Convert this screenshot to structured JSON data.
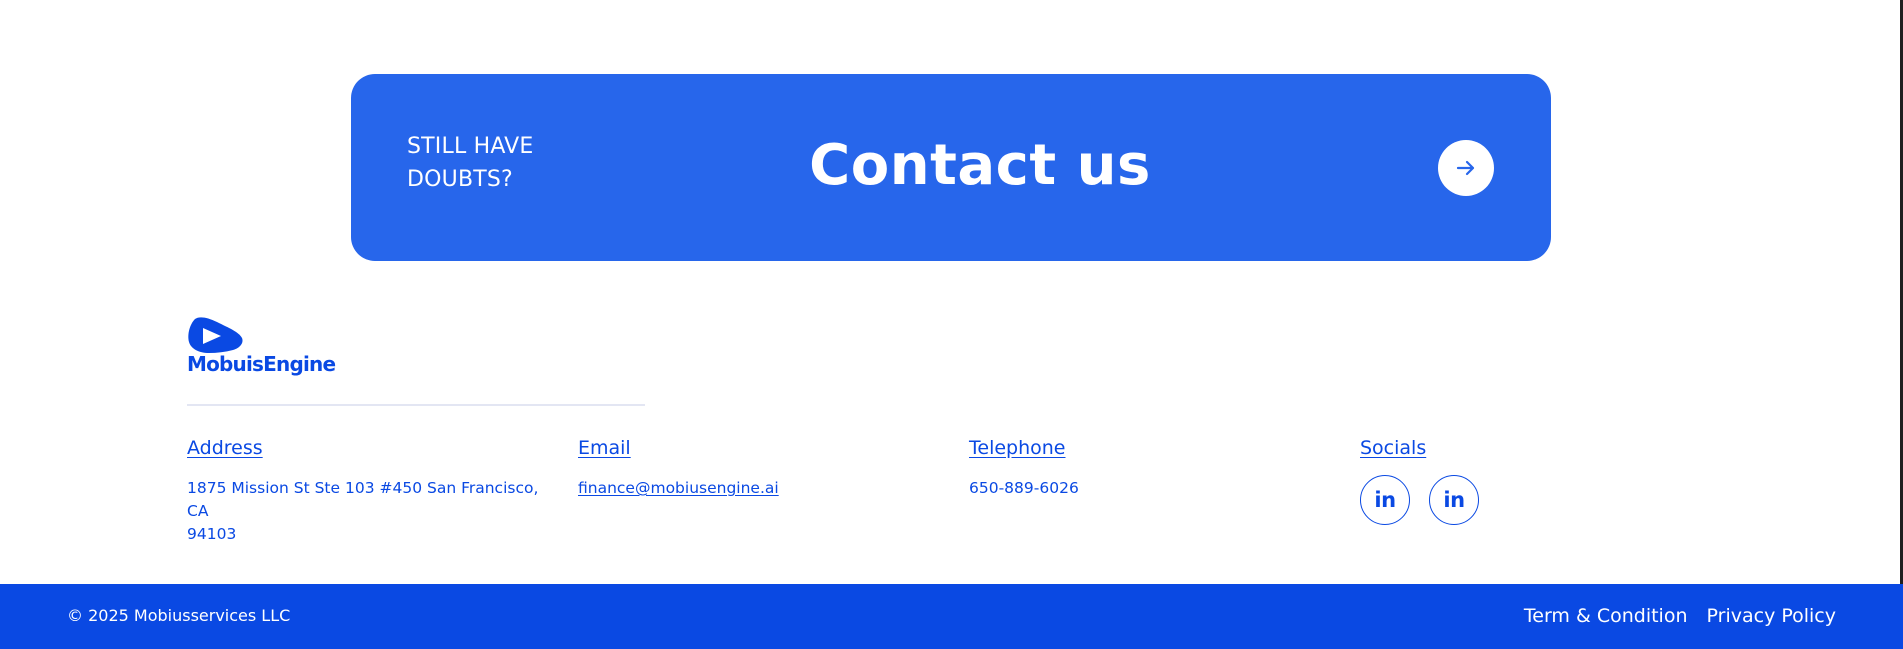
{
  "colors": {
    "cta_background": "#2766eb",
    "brand_blue": "#0a49e3",
    "divider": "#e3e6f3",
    "background": "#ffffff"
  },
  "cta": {
    "kicker_line1": "STILL HAVE",
    "kicker_line2": "DOUBTS?",
    "title": "Contact us",
    "arrow_icon": "arrow-right-icon"
  },
  "logo": {
    "text": "MobuisEngine"
  },
  "contact": {
    "address": {
      "heading": "Address",
      "line1": "1875 Mission St Ste 103 #450 San Francisco, CA",
      "line2": "94103"
    },
    "email": {
      "heading": "Email",
      "value": "finance@mobiusengine.ai"
    },
    "telephone": {
      "heading": "Telephone",
      "value": "650-889-6026"
    },
    "socials": {
      "heading": "Socials",
      "items": [
        {
          "icon": "linkedin-icon",
          "glyph": "in"
        },
        {
          "icon": "linkedin-icon",
          "glyph": "in"
        }
      ]
    }
  },
  "footer": {
    "copyright": "© 2025 Mobiusservices LLC",
    "links": [
      "Term & Condition",
      "Privacy Policy"
    ]
  }
}
